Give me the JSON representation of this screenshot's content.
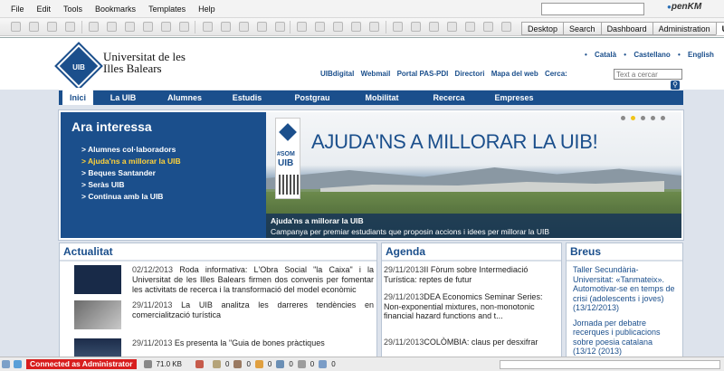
{
  "menubar": {
    "items": [
      "File",
      "Edit",
      "Tools",
      "Bookmarks",
      "Templates",
      "Help"
    ],
    "search_value": "",
    "logo": "penKM"
  },
  "tabs": [
    "Desktop",
    "Search",
    "Dashboard",
    "Administration",
    "UIB"
  ],
  "active_tab": "UIB",
  "uib": {
    "name_line1": "Universitat de les",
    "name_line2": "Illes Balears",
    "logo_text": "UIB",
    "languages": [
      "Català",
      "Castellano",
      "English"
    ],
    "quick_links": [
      "UIBdigital",
      "Webmail",
      "Portal PAS-PDI",
      "Directori",
      "Mapa del web",
      "Cerca:"
    ],
    "search_placeholder": "Text a cercar",
    "nav": [
      "Inici",
      "La UIB",
      "Alumnes",
      "Estudis",
      "Postgrau",
      "Mobilitat",
      "Recerca",
      "Empreses"
    ],
    "hero": {
      "title": "Ara interessa",
      "links": [
        "Alumnes col·laboradors",
        "Ajuda'ns a millorar la UIB",
        "Beques Santander",
        "Seràs UIB",
        "Continua amb la UIB"
      ],
      "selected_index": 1,
      "headline": "AJUDA'NS A MILLORAR LA UIB!",
      "poster_tag": "#SOM",
      "poster_word": "UIB",
      "caption_title": "Ajuda'ns a millorar la UIB",
      "caption_sub": "Campanya per premiar estudiants que proposin accions i idees per millorar la UIB"
    },
    "actualitat": {
      "title": "Actualitat",
      "items": [
        {
          "date": "02/12/2013",
          "text": "Roda informativa: L'Obra Social \"la Caixa\" i la Universitat de les Illes Balears firmen dos convenis per fomentar les activitats de recerca i la transformació del model econòmic"
        },
        {
          "date": "29/11/2013",
          "text": "La UIB analitza les darreres tendències en comercialització turística"
        },
        {
          "date": "29/11/2013",
          "text": "Es presenta la \"Guia de bones pràctiques"
        }
      ]
    },
    "agenda": {
      "title": "Agenda",
      "items": [
        {
          "date": "29/11/2013",
          "text": "II Fòrum sobre Intermediació Turística: reptes de futur"
        },
        {
          "date": "29/11/2013",
          "text": "DEA Economics Seminar Series: Non-exponential mixtures, non-monotonic financial hazard functions and t..."
        },
        {
          "date": "29/11/2013",
          "text": "COLÒMBIA: claus per desxifrar"
        }
      ]
    },
    "breus": {
      "title": "Breus",
      "items": [
        "Taller Secundària-Universitat: «Tanmateix». Automotivar-se en temps de crisi (adolescents i joves) (13/12/2013)",
        "Jornada per debatre recerques i publicacions sobre poesia catalana (13/12 (2013)"
      ]
    }
  },
  "statusbar": {
    "connected": "Connected as Administrator",
    "size": "71.0 KB",
    "counts": [
      "0",
      "0",
      "0",
      "0",
      "0",
      "0"
    ]
  },
  "colors": {
    "uib_blue": "#1b4f8c",
    "highlight": "#ffd23a",
    "connected_bg": "#d81e1e"
  }
}
